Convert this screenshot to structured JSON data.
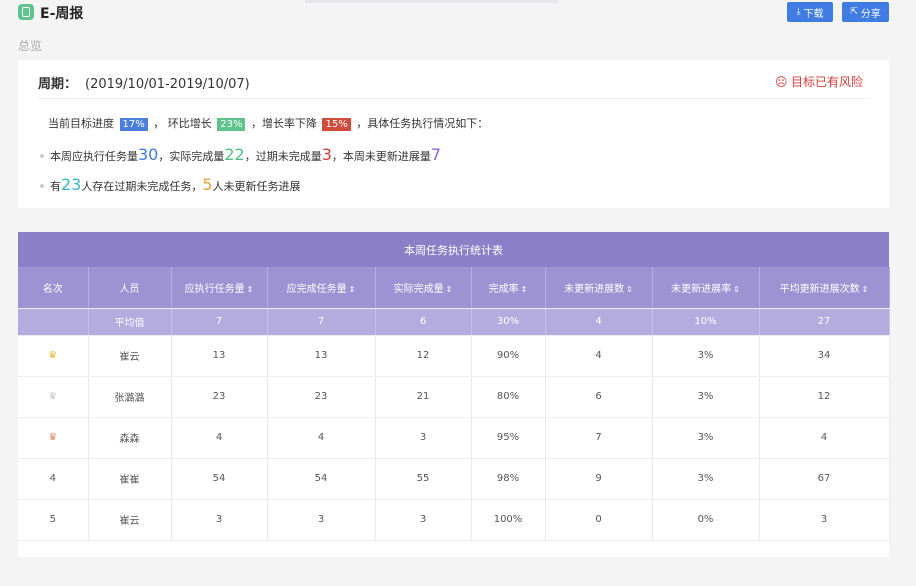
{
  "header": {
    "title": "E-周报",
    "download_label": "下载",
    "share_label": "分享"
  },
  "section_label": "总览",
  "overview": {
    "period_label": "周期：",
    "period_range": "(2019/10/01-2019/10/07)",
    "risk_text": "目标已有风险",
    "line1": {
      "p1": "当前目标进度",
      "progress": "17%",
      "p2": "，  环比增长",
      "growth": "23%",
      "p3": "，增长率下降",
      "decline": "15%",
      "p4": "，具体任务执行情况如下："
    },
    "bullet1": {
      "p1": "本周应执行任务量",
      "planned": "30",
      "p2": "，实际完成量",
      "done": "22",
      "p3": "，过期未完成量",
      "overdue": "3",
      "p4": "，本周未更新进展量",
      "not_updated": "7"
    },
    "bullet2": {
      "p1": "有",
      "overdue_people": "23",
      "p2": "人存在过期未完成任务，",
      "stale_people": "5",
      "p3": "人未更新任务进展"
    }
  },
  "table": {
    "title": "本周任务执行统计表",
    "columns": [
      "名次",
      "人员",
      "应执行任务量",
      "应完成任务量",
      "实际完成量",
      "完成率",
      "未更新进展数",
      "未更新进展率",
      "平均更新进展次数"
    ],
    "average": [
      "",
      "平均值",
      "7",
      "7",
      "6",
      "30%",
      "4",
      "10%",
      "27"
    ],
    "rows": [
      [
        "",
        "崔云",
        "13",
        "13",
        "12",
        "90%",
        "4",
        "3%",
        "34"
      ],
      [
        "",
        "张潞潞",
        "23",
        "23",
        "21",
        "80%",
        "6",
        "3%",
        "12"
      ],
      [
        "",
        "森森",
        "4",
        "4",
        "3",
        "95%",
        "7",
        "3%",
        "4"
      ],
      [
        "4",
        "崔崔",
        "54",
        "54",
        "55",
        "98%",
        "9",
        "3%",
        "67"
      ],
      [
        "5",
        "崔云",
        "3",
        "3",
        "3",
        "100%",
        "0",
        "0%",
        "3"
      ]
    ]
  },
  "colors": {
    "accent": "#3f7ce3",
    "table_header": "#8b80c7",
    "risk": "#d43c3c"
  },
  "icons": {
    "app": "report-app-icon",
    "download": "download-icon",
    "share": "share-icon",
    "risk": "sad-face-icon",
    "sort": "sort-icon",
    "rank": "crown-icon"
  }
}
